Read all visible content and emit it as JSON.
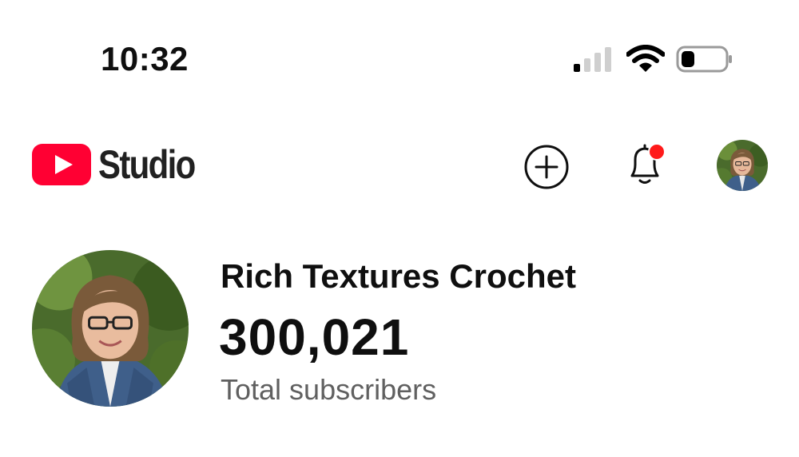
{
  "status_bar": {
    "time": "10:32",
    "signal_bars_active": 1,
    "signal_bars_total": 4,
    "battery_level": 0.3,
    "icons": [
      "cellular-signal-icon",
      "wifi-icon",
      "battery-icon"
    ]
  },
  "header": {
    "brand": "Studio",
    "logo_icon": "youtube-play-icon",
    "create_icon": "plus-circle-icon",
    "notifications_icon": "bell-icon",
    "has_unread_notifications": true
  },
  "channel": {
    "name": "Rich Textures Crochet",
    "subscriber_count": "300,021",
    "subscriber_label": "Total subscribers"
  },
  "colors": {
    "brand_red": "#ff0000",
    "text_primary": "#0f0f0f",
    "text_secondary": "#606060",
    "notification_dot": "#ff0000"
  }
}
